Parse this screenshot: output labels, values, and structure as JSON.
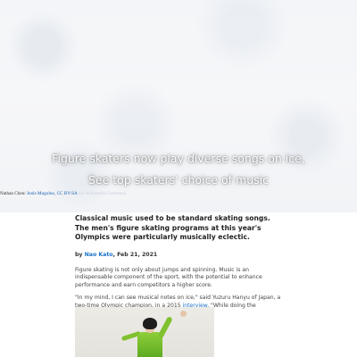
{
  "hero": {
    "title_line1": "Figure skaters now play diverse songs on ice,",
    "title_line2": "See top skaters' choice of music"
  },
  "credit": {
    "author": "Nathan Chen/",
    "source_link": "Jools Mugoloo,",
    "license": "CC BY-SA",
    "faded_text": "via Wikimedia Commons"
  },
  "article": {
    "lead": "Classical music used to be standard skating songs. The men's figure skating programs at this year's Olympics were particularly musically eclectic.",
    "byline_prefix": "by ",
    "byline_author": "Nao Kato",
    "byline_date": ", Feb 21, 2021",
    "paragraph1": "Figure skating is not only about jumps and spinning. Music is an indispensable component of the sport, with the potential to enhance performance and earn competitors a higher score.",
    "paragraph2_before": "\"In my mind, I can see musical notes on ice,\" said Yuzuru Hanyu of Japan, a two-time Olympic champion, in a 2015 ",
    "paragraph2_link": "interview",
    "paragraph2_after": ". \"While doing the choreography, I skate on the notes.\""
  }
}
